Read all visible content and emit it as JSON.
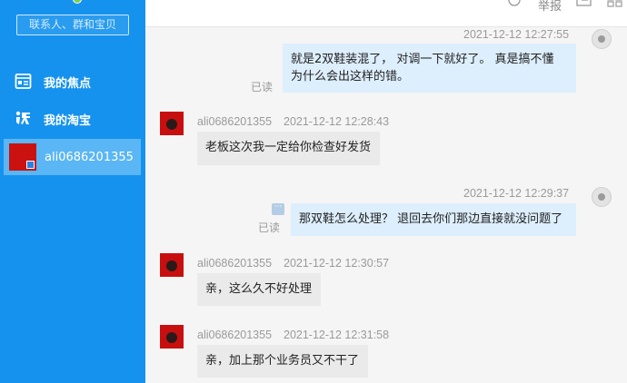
{
  "sidebar": {
    "search_placeholder": "联系人、群和宝贝",
    "items": [
      {
        "label": "我的焦点",
        "icon": "focus-card-icon"
      },
      {
        "label": "我的淘宝",
        "icon": "taobao-logo-icon"
      },
      {
        "label": "ali0686201355",
        "icon": "shop-avatar"
      }
    ]
  },
  "topbar": {
    "report_label": "举报"
  },
  "messages": [
    {
      "direction": "out",
      "timestamp": "2021-12-12 12:27:55",
      "text_line1": "就是2双鞋装混了， 对调一下就好了。 真是搞不懂",
      "text_line2": "为什么会出这样的错。",
      "status": "已读"
    },
    {
      "direction": "in",
      "sender": "ali0686201355",
      "timestamp": "2021-12-12 12:28:43",
      "text": "老板这次我一定给你检查好发货"
    },
    {
      "direction": "out",
      "timestamp": "2021-12-12 12:29:37",
      "text": "那双鞋怎么处理？ 退回去你们那边直接就没问题了",
      "status": "已读"
    },
    {
      "direction": "in",
      "sender": "ali0686201355",
      "timestamp": "2021-12-12 12:30:57",
      "text": "亲，这么久不好处理"
    },
    {
      "direction": "in",
      "sender": "ali0686201355",
      "timestamp": "2021-12-12 12:31:58",
      "text": "亲，加上那个业务员又不干了"
    }
  ],
  "colors": {
    "sidebar_bg": "#1592ee",
    "sidebar_active": "#5ab6f5",
    "chat_bg": "#f5f5f5",
    "bubble_out": "#ddeefc",
    "bubble_in": "#eaeaea"
  }
}
